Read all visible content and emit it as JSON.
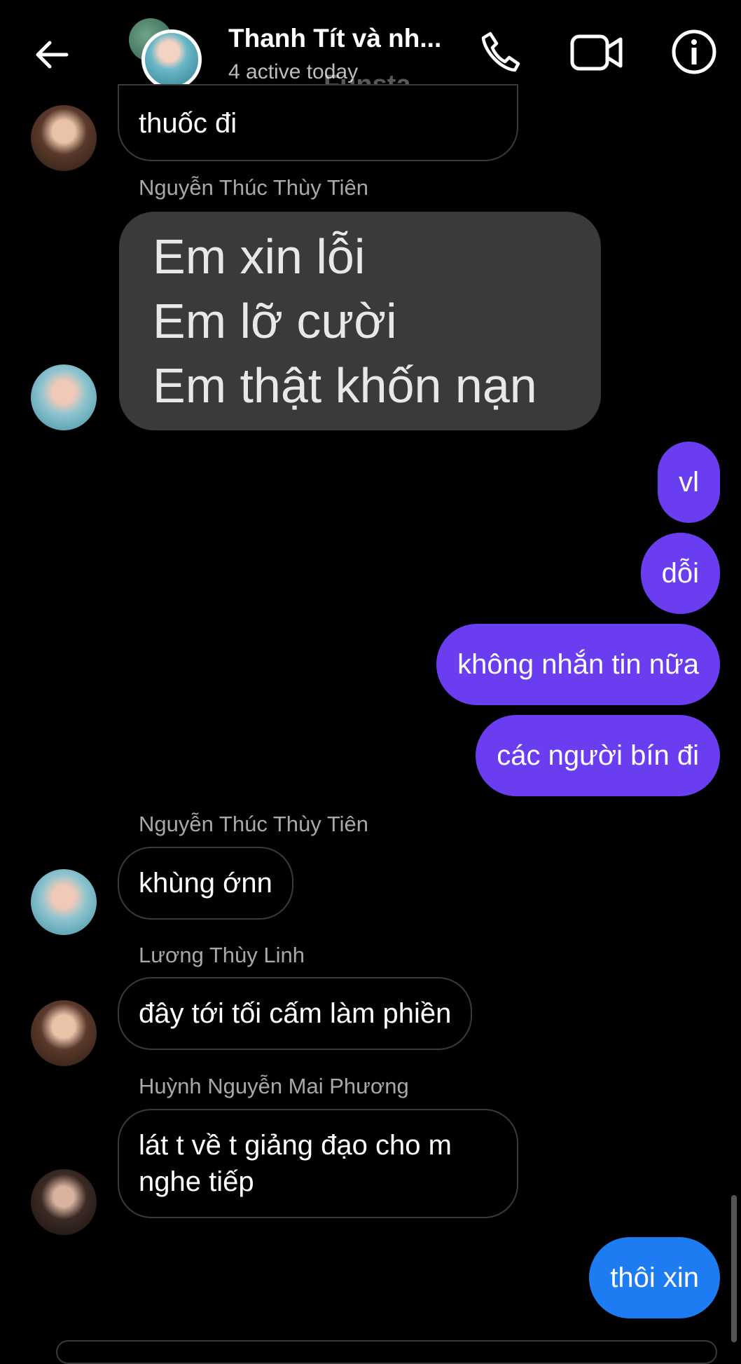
{
  "header": {
    "title": "Thanh Tít và nh...",
    "subtitle": "4 active today",
    "watermark": "Funsta",
    "icons": [
      "back-arrow-icon",
      "phone-icon",
      "video-icon",
      "info-icon"
    ]
  },
  "messages": {
    "m0_text": "thuốc đi",
    "sender_tien": "Nguyễn Thúc Thùy Tiên",
    "image_lines": [
      "Em xin lỗi",
      "Em lỡ cười",
      "Em thật khốn nạn"
    ],
    "out1": "vl",
    "out2": "dỗi",
    "out3": "không nhắn tin nữa",
    "out4": "các người bín đi",
    "sender_tien2": "Nguyễn Thúc Thùy Tiên",
    "in_tien": "khùng ớnn",
    "sender_linh": "Lương Thùy Linh",
    "in_linh": "đây tới tối cấm làm phiền",
    "sender_phuong": "Huỳnh Nguyễn Mai Phương",
    "in_phuong_l1": "lát t về t giảng đạo cho m",
    "in_phuong_l2": "nghe tiếp",
    "out5": "thôi xin"
  },
  "colors": {
    "outgoing_purple": "#6a3df0",
    "outgoing_blue": "#1d7cf2",
    "incoming_border": "#3a3a3a"
  }
}
